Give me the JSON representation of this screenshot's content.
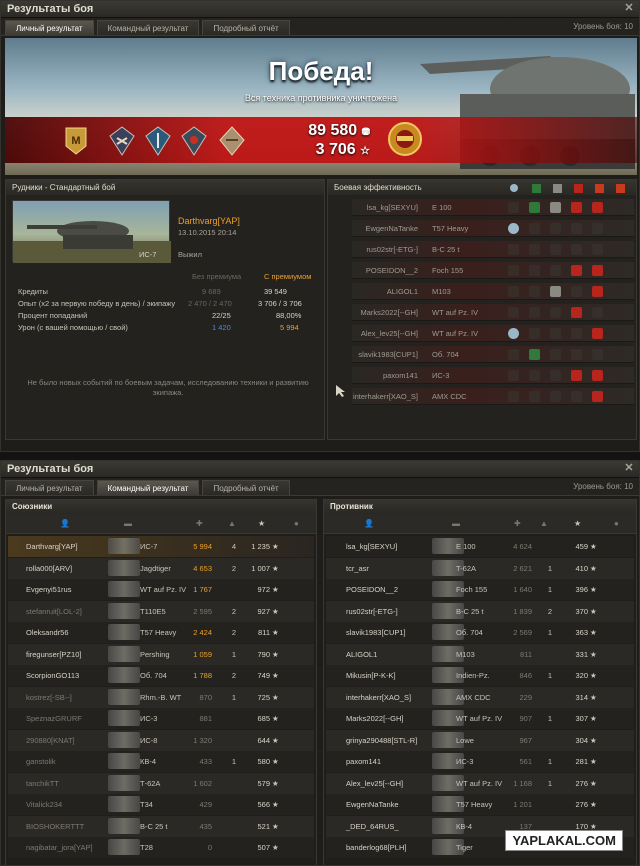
{
  "win1": {
    "title": "Результаты боя",
    "tabs": [
      "Личный результат",
      "Командный результат",
      "Подробный отчёт"
    ],
    "level": "Уровень боя: 10"
  },
  "banner": {
    "victory": "Победа!",
    "subtitle": "Вся техника противника уничтожена",
    "credits": "89 580",
    "exp": "3 706",
    "medals": [
      "mastery-badge-icon",
      "award-icon",
      "award-icon",
      "award-icon",
      "award-icon"
    ]
  },
  "personal": {
    "map": "Рудники - Стандартный бой",
    "player": "Darthvarg[YAP]",
    "date": "13.10.2015 20:14",
    "tank": "ИС-7",
    "status": "Выжил",
    "col_no_premium": "Без премиума",
    "col_premium": "С премиумом",
    "rows": [
      {
        "label": "Кредиты",
        "base": "9 689",
        "prem": "39 549"
      },
      {
        "label": "Опыт (x2 за первую победу в день) / экипажу",
        "base": "2 470 / 2 470",
        "prem": "3 706 / 3 706"
      },
      {
        "label": "Процент попаданий",
        "base": "22/25",
        "prem": "88,00%"
      },
      {
        "label": "Урон (с вашей помощью / свой)",
        "base": "1 420",
        "prem": "5 994"
      }
    ],
    "hint": "Не было новых событий по боевым задачам, исследованию техники и развитию экипажа."
  },
  "efficiency": {
    "title": "Боевая эффективность",
    "rows": [
      {
        "name": "lsa_kg[SEXYU]",
        "tank": "E 100",
        "icons": [
          "off",
          "g",
          "s",
          "r",
          "r"
        ]
      },
      {
        "name": "EwgenNaTanke",
        "tank": "T57 Heavy",
        "icons": [
          "b",
          "off",
          "off",
          "off",
          "off"
        ]
      },
      {
        "name": "rus02str[-ETG-]",
        "tank": "B-C 25 t",
        "icons": [
          "off",
          "off",
          "off",
          "off",
          "off"
        ]
      },
      {
        "name": "POSEIDON__2",
        "tank": "Foch 155",
        "icons": [
          "off",
          "off",
          "off",
          "r",
          "r"
        ]
      },
      {
        "name": "ALIGOL1",
        "tank": "M103",
        "icons": [
          "off",
          "off",
          "s",
          "off",
          "r"
        ]
      },
      {
        "name": "Marks2022[--GH]",
        "tank": "WT auf Pz. IV",
        "icons": [
          "off",
          "off",
          "off",
          "r",
          "off"
        ]
      },
      {
        "name": "Alex_lev25[--GH]",
        "tank": "WT auf Pz. IV",
        "icons": [
          "b",
          "off",
          "off",
          "off",
          "r"
        ]
      },
      {
        "name": "slavik1983[CUP1]",
        "tank": "Об. 704",
        "icons": [
          "off",
          "g",
          "off",
          "off",
          "off"
        ]
      },
      {
        "name": "paxom141",
        "tank": "ИС-3",
        "icons": [
          "off",
          "off",
          "off",
          "r",
          "r"
        ]
      },
      {
        "name": "interhakerr[XAO_S]",
        "tank": "AMX CDC",
        "icons": [
          "off",
          "off",
          "off",
          "off",
          "r"
        ]
      }
    ]
  },
  "win2": {
    "title": "Результаты боя",
    "tabs": [
      "Личный результат",
      "Командный результат",
      "Подробный отчёт"
    ],
    "level": "Уровень боя: 10"
  },
  "allies": {
    "title": "Союзники",
    "players": [
      {
        "name": "Darthvarg[YAP]",
        "tank": "ИС-7",
        "dmg": "5 994",
        "kills": "4",
        "xp": "1 235",
        "alive": true,
        "self": true
      },
      {
        "name": "rolla000[ARV]",
        "tank": "Jagdtiger",
        "dmg": "4 653",
        "kills": "2",
        "xp": "1 007",
        "alive": true
      },
      {
        "name": "Evgenyi51rus",
        "tank": "WT auf Pz. IV",
        "dmg": "1 767",
        "kills": "",
        "xp": "972",
        "alive": true
      },
      {
        "name": "stefanruit[LOL-2]",
        "tank": "T110E5",
        "dmg": "2 595",
        "kills": "2",
        "xp": "927",
        "alive": false
      },
      {
        "name": "Oleksandr56",
        "tank": "T57 Heavy",
        "dmg": "2 424",
        "kills": "2",
        "xp": "811",
        "alive": true
      },
      {
        "name": "firegunser[PZ10]",
        "tank": "Pershing",
        "dmg": "1 059",
        "kills": "1",
        "xp": "790",
        "alive": true
      },
      {
        "name": "ScorpionGO113",
        "tank": "Об. 704",
        "dmg": "1 788",
        "kills": "2",
        "xp": "749",
        "alive": true
      },
      {
        "name": "kostrez[-SB--]",
        "tank": "Rhm.-B. WT",
        "dmg": "870",
        "kills": "1",
        "xp": "725",
        "alive": false
      },
      {
        "name": "SpeznazGRURF",
        "tank": "ИС-3",
        "dmg": "881",
        "kills": "",
        "xp": "685",
        "alive": false
      },
      {
        "name": "290880[KNAT]",
        "tank": "ИС-8",
        "dmg": "1 320",
        "kills": "",
        "xp": "644",
        "alive": false
      },
      {
        "name": "ganstolik",
        "tank": "КВ-4",
        "dmg": "433",
        "kills": "1",
        "xp": "580",
        "alive": false
      },
      {
        "name": "tanchikTT",
        "tank": "Т-62А",
        "dmg": "1 602",
        "kills": "",
        "xp": "579",
        "alive": false
      },
      {
        "name": "Vitalick234",
        "tank": "T34",
        "dmg": "429",
        "kills": "",
        "xp": "566",
        "alive": false
      },
      {
        "name": "BIOSHOKERTTT",
        "tank": "B-C 25 t",
        "dmg": "435",
        "kills": "",
        "xp": "521",
        "alive": false
      },
      {
        "name": "nagibatar_jora[YAP]",
        "tank": "T28",
        "dmg": "0",
        "kills": "",
        "xp": "507",
        "alive": false
      }
    ]
  },
  "enemies": {
    "title": "Противник",
    "players": [
      {
        "name": "lsa_kg[SEXYU]",
        "tank": "E 100",
        "dmg": "4 624",
        "kills": "",
        "xp": "459"
      },
      {
        "name": "tcr_asr",
        "tank": "T-62A",
        "dmg": "2 621",
        "kills": "1",
        "xp": "410"
      },
      {
        "name": "POSEIDON__2",
        "tank": "Foch 155",
        "dmg": "1 640",
        "kills": "1",
        "xp": "396"
      },
      {
        "name": "rus02str[-ETG-]",
        "tank": "B-C 25 t",
        "dmg": "1 839",
        "kills": "2",
        "xp": "370"
      },
      {
        "name": "slavik1983[CUP1]",
        "tank": "Об. 704",
        "dmg": "2 569",
        "kills": "1",
        "xp": "363"
      },
      {
        "name": "ALIGOL1",
        "tank": "M103",
        "dmg": "811",
        "kills": "",
        "xp": "331"
      },
      {
        "name": "Mikusin[P-K-K]",
        "tank": "Indien-Pz.",
        "dmg": "846",
        "kills": "1",
        "xp": "320"
      },
      {
        "name": "interhakerr[XAO_S]",
        "tank": "AMX CDC",
        "dmg": "229",
        "kills": "",
        "xp": "314"
      },
      {
        "name": "Marks2022[--GH]",
        "tank": "WT auf Pz. IV",
        "dmg": "907",
        "kills": "1",
        "xp": "307"
      },
      {
        "name": "grinya290488[STL-R]",
        "tank": "Lowe",
        "dmg": "967",
        "kills": "",
        "xp": "304"
      },
      {
        "name": "paxom141",
        "tank": "ИС-3",
        "dmg": "561",
        "kills": "1",
        "xp": "281"
      },
      {
        "name": "Alex_lev25[--GH]",
        "tank": "WT auf Pz. IV",
        "dmg": "1 168",
        "kills": "1",
        "xp": "276"
      },
      {
        "name": "EwgenNaTanke",
        "tank": "T57 Heavy",
        "dmg": "1 201",
        "kills": "",
        "xp": "276"
      },
      {
        "name": "_DED_64RUS_",
        "tank": "КВ-4",
        "dmg": "137",
        "kills": "",
        "xp": "170"
      },
      {
        "name": "banderlog68[PLH]",
        "tank": "Tiger",
        "dmg": "0",
        "kills": "",
        "xp": "161"
      }
    ]
  },
  "watermark": "YAPLAKAL.COM"
}
